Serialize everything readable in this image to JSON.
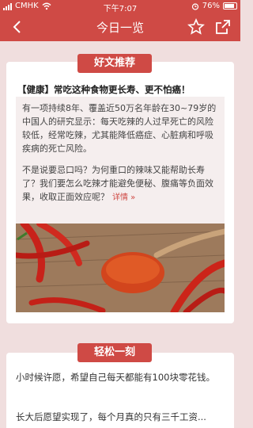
{
  "status": {
    "carrier": "CMHK",
    "time": "下午7:07",
    "battery": "76%"
  },
  "nav": {
    "title": "今日一览"
  },
  "section1": {
    "label": "好文推荐",
    "headline": "【健康】常吃这种食物更长寿、更不怕癌！",
    "para1": "有一项持续8年、覆盖近50万名年龄在30~79岁的中国人的研究显示：每天吃辣的人过早死亡的风险较低，经常吃辣，尤其能降低癌症、心脏病和呼吸疾病的死亡风险。",
    "para2": "不是说要忌口吗？为何重口的辣味又能帮助长寿了？我们要怎么吃辣才能避免便秘、腹痛等负面效果，收取正面效应呢？",
    "more": "详情 »"
  },
  "section2": {
    "label": "轻松一刻",
    "line1": "小时候许愿，希望自己每天都能有100块零花钱。",
    "line2": "长大后愿望实现了，每个月真的只有三千工资..."
  },
  "colors": {
    "accent": "#cf4a45",
    "background": "#f0dede"
  }
}
